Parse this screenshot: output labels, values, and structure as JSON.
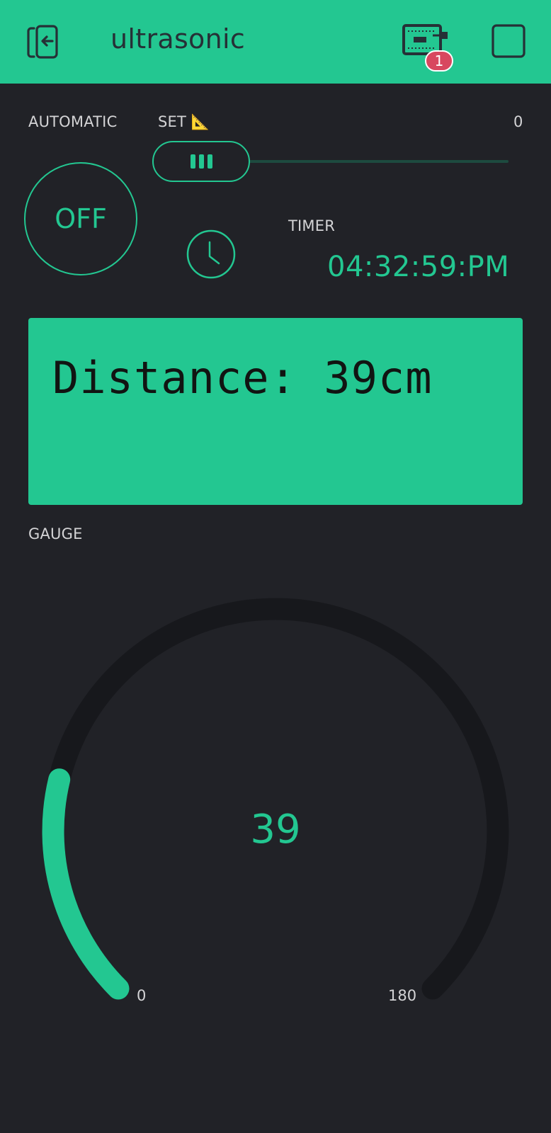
{
  "header": {
    "title": "ultrasonic",
    "back_icon": "exit-app-icon",
    "device_icon": "device-board-icon",
    "device_badge": "1",
    "stop_icon": "stop-square-icon"
  },
  "automatic": {
    "label": "AUTOMATIC",
    "state": "OFF"
  },
  "set_slider": {
    "label": "SET 📐",
    "value": "0"
  },
  "timer": {
    "label": "TIMER",
    "value": "04:32:59:PM",
    "icon": "clock-icon"
  },
  "lcd": {
    "line1": "Distance: 39cm",
    "line2": ""
  },
  "gauge": {
    "label": "GAUGE",
    "value": 39,
    "value_text": "39",
    "min": "0",
    "max": "180",
    "min_value": 0,
    "max_value": 180
  },
  "colors": {
    "accent": "#23c791",
    "background": "#212227",
    "gauge_track": "#17181c",
    "badge": "#d8475f"
  }
}
